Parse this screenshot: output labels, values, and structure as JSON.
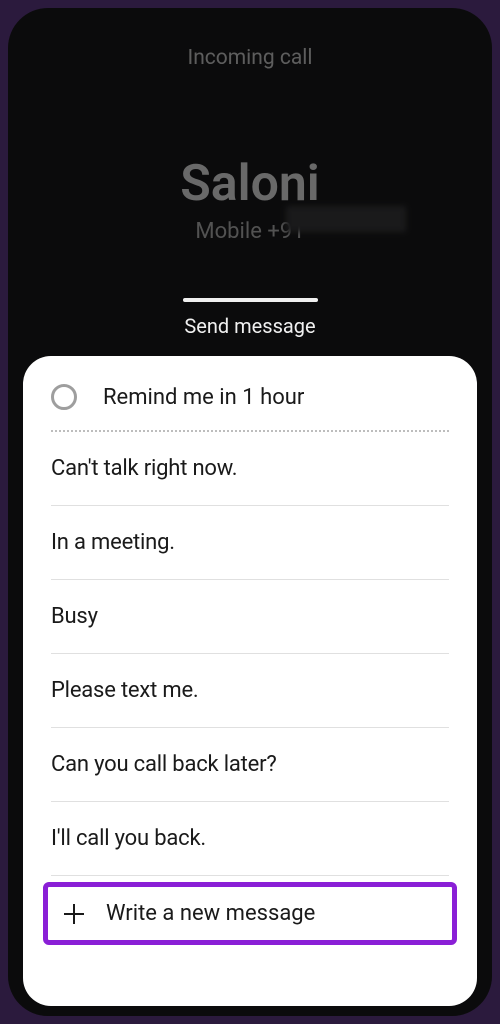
{
  "call": {
    "status_label": "Incoming call",
    "caller_name": "Saloni",
    "caller_line": "Mobile  +91"
  },
  "sheet": {
    "title": "Send message",
    "reminder_label": "Remind me in 1 hour",
    "quick_replies": [
      "Can't talk right now.",
      "In a meeting.",
      "Busy",
      "Please text me.",
      "Can you call back later?",
      "I'll call you back."
    ],
    "new_message_label": "Write a new message"
  },
  "highlight_color": "#8a1fd6"
}
